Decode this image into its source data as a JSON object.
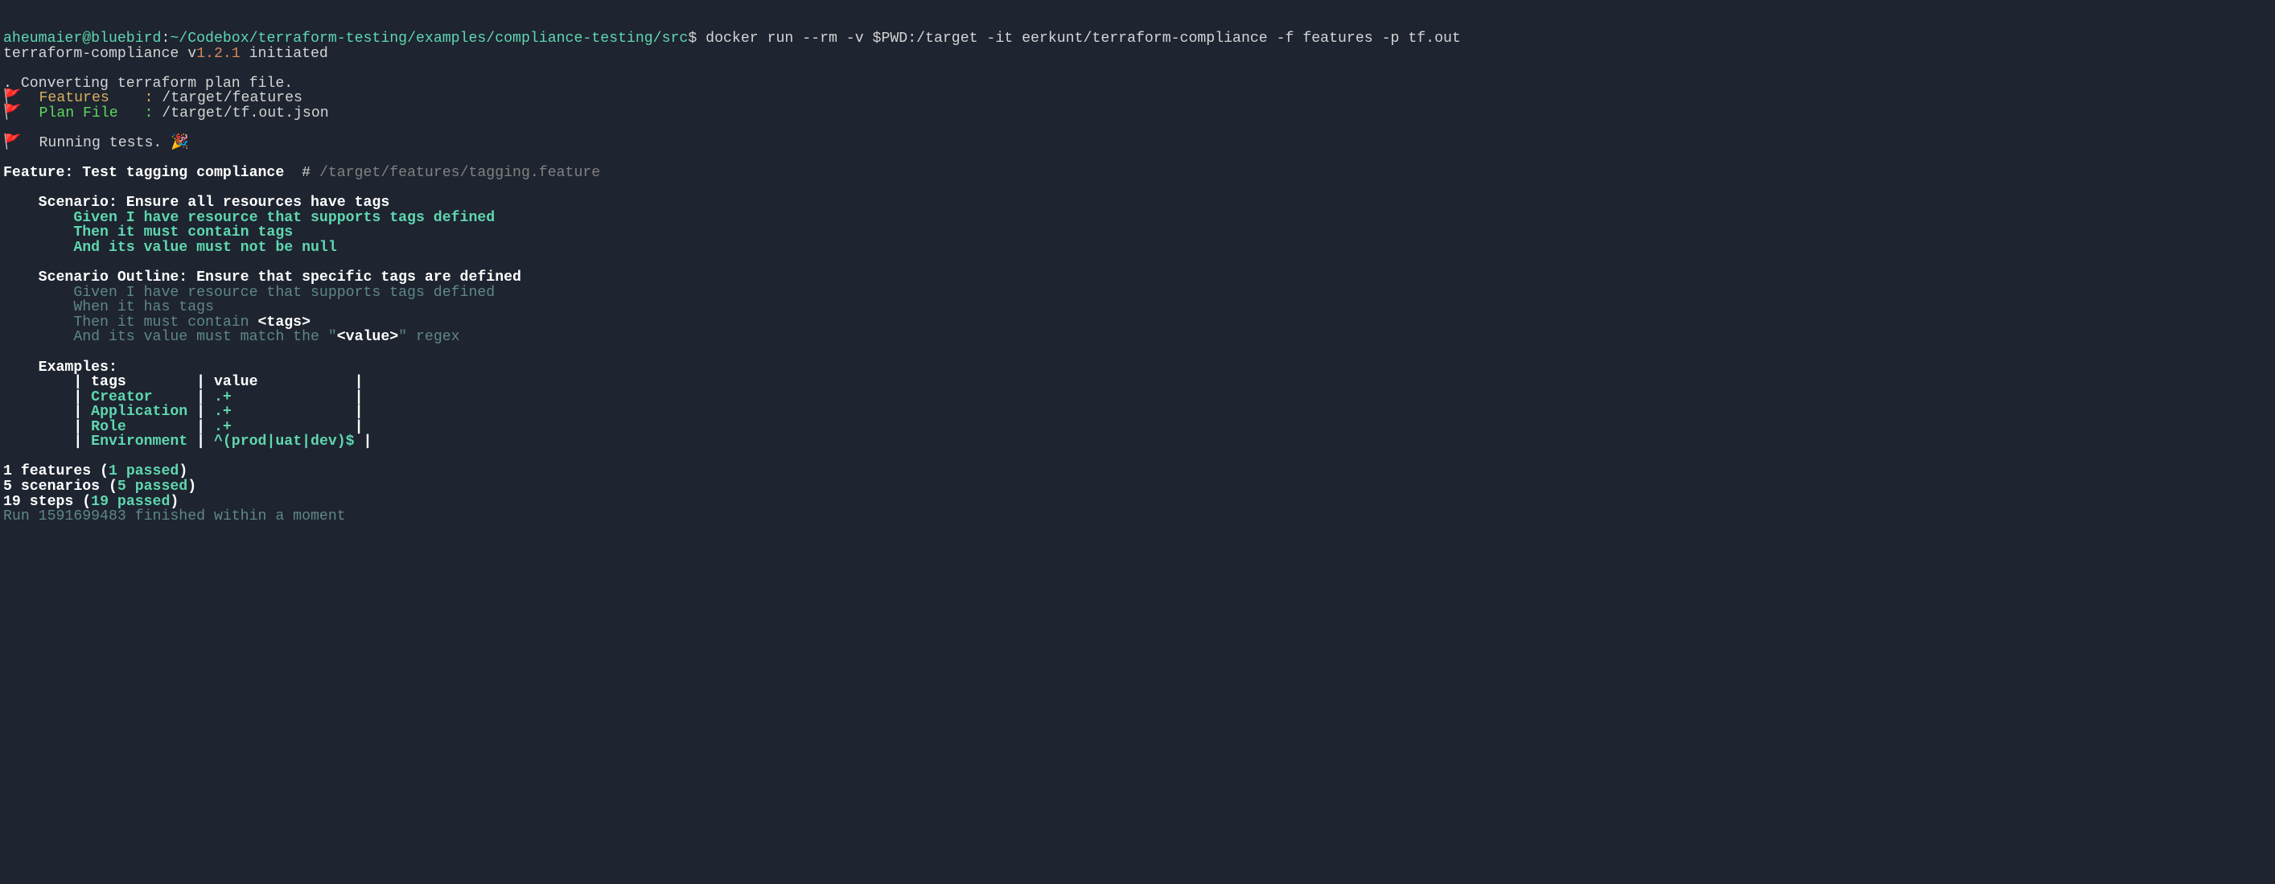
{
  "prompt": {
    "user": "aheumaier@bluebird",
    "sep1": ":",
    "path": "~/Codebox/terraform-testing/examples/compliance-testing/src",
    "sep2": "$",
    "command": " docker run --rm -v $PWD:/target -it eerkunt/terraform-compliance -f features -p tf.out"
  },
  "init": {
    "prefix": "terraform-compliance v",
    "version": "1.2.1",
    "suffix": " initiated"
  },
  "convert": ". Converting terraform plan file.",
  "features_label": "  Features    : ",
  "features_path": "/target/features",
  "plan_label": "  Plan File   : ",
  "plan_path": "/target/tf.out.json",
  "running": "  Running tests. ",
  "party": "🎉",
  "flag": "🚩",
  "feature": {
    "label": "Feature: Test tagging compliance  ",
    "comment_hash": "# ",
    "comment_path": "/target/features/tagging.feature"
  },
  "scenario1": {
    "title": "    Scenario: Ensure all resources have tags",
    "given": "        Given I have resource that supports tags defined",
    "then": "        Then it must contain tags",
    "and": "        And its value must not be null"
  },
  "scenario2": {
    "title": "    Scenario Outline: Ensure that specific tags are defined",
    "given": "        Given I have resource that supports tags defined",
    "when": "        When it has tags",
    "then": "        Then it must contain ",
    "then_tag": "<tags>",
    "and1": "        And its value must match the \"",
    "and_value": "<value>",
    "and2": "\" regex"
  },
  "examples": {
    "title": "    Examples:",
    "header": "        | tags        | value           |",
    "rows": [
      {
        "pre": "        | ",
        "tag": "Creator    ",
        "mid": " | ",
        "val": ".+             ",
        "end": " |"
      },
      {
        "pre": "        | ",
        "tag": "Application",
        "mid": " | ",
        "val": ".+             ",
        "end": " |"
      },
      {
        "pre": "        | ",
        "tag": "Role       ",
        "mid": " | ",
        "val": ".+             ",
        "end": " |"
      },
      {
        "pre": "        | ",
        "tag": "Environment",
        "mid": " | ",
        "val": "^(prod|uat|dev)$",
        "end": " |"
      }
    ]
  },
  "summary": {
    "features_a": "1 features (",
    "features_b": "1 passed",
    "features_c": ")",
    "scenarios_a": "5 scenarios (",
    "scenarios_b": "5 passed",
    "scenarios_c": ")",
    "steps_a": "19 steps (",
    "steps_b": "19 passed",
    "steps_c": ")"
  },
  "runline": "Run 1591699483 finished within a moment"
}
